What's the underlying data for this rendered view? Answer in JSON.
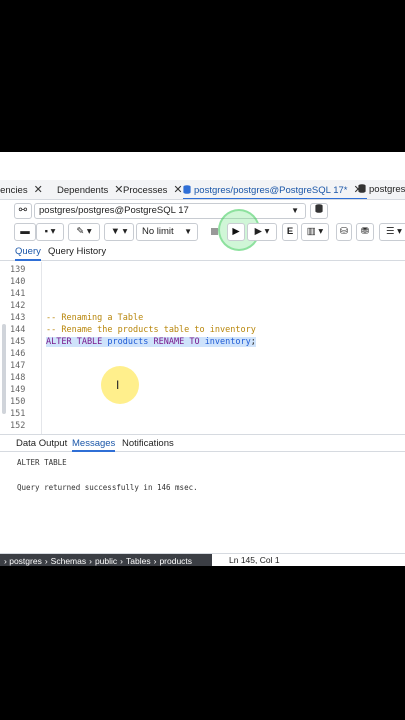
{
  "tabs": [
    {
      "label": "lencies",
      "active": false
    },
    {
      "label": "Dependents",
      "active": false
    },
    {
      "label": "Processes",
      "active": false
    },
    {
      "label": "postgres/postgres@PostgreSQL 17*",
      "active": true
    },
    {
      "label": "postgres/",
      "active": false
    }
  ],
  "connection": {
    "value": "postgres/postgres@PostgreSQL 17"
  },
  "toolbar": {
    "limit": "No limit"
  },
  "query_tabs": [
    "Query",
    "Query History"
  ],
  "editor": {
    "line_numbers": [
      "139",
      "140",
      "141",
      "142",
      "143",
      "144",
      "145",
      "146",
      "147",
      "148",
      "149",
      "150",
      "151",
      "152"
    ],
    "comment1": "-- Renaming a Table",
    "comment2": "-- Rename the products table to inventory",
    "sql_alter": "ALTER TABLE",
    "sql_table": "products",
    "sql_rename": "RENAME TO",
    "sql_new": "inventory",
    "sql_end": ";"
  },
  "result_tabs": [
    "Data Output",
    "Messages",
    "Notifications"
  ],
  "messages": {
    "line1": "ALTER TABLE",
    "line2": "Query returned successfully in 146 msec."
  },
  "status": {
    "crumbs": [
      "postgres",
      "Schemas",
      "public",
      "Tables",
      "products"
    ],
    "position": "Ln 145, Col 1"
  },
  "colors": {
    "accent": "#2f6fd6",
    "keyword": "#7a1a8c",
    "comment": "#b8860b",
    "identifier": "#1e5bd6"
  }
}
